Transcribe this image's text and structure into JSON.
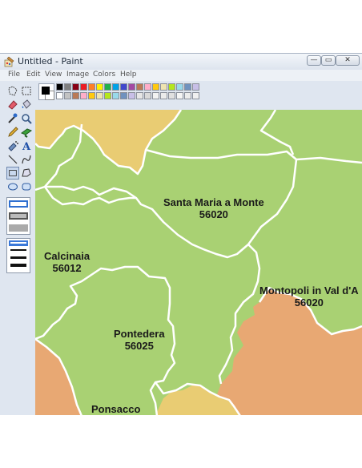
{
  "window": {
    "title": "Untitled - Paint"
  },
  "menu": [
    "File",
    "Edit",
    "View",
    "Image",
    "Colors",
    "Help"
  ],
  "window_controls": [
    {
      "name": "minimize",
      "symbol": "—"
    },
    {
      "name": "maximize",
      "symbol": "▭"
    },
    {
      "name": "close",
      "symbol": "✕"
    }
  ],
  "palette": {
    "primary_color": "#000000",
    "secondary_color": "#ffffff",
    "top_row": [
      "#000000",
      "#7f7f7f",
      "#880015",
      "#ed1c24",
      "#ff7f27",
      "#fff200",
      "#22b14c",
      "#00a2e8",
      "#3f48cc",
      "#a349a4",
      "#b97a57",
      "#ffaec9",
      "#ffc90e",
      "#efe4b0",
      "#b5e61d",
      "#99d9ea",
      "#7092be",
      "#c8bfe7"
    ],
    "bottom_row": [
      "#ffffff",
      "#c3c3c3",
      "#b97a57",
      "#ffaec9",
      "#ffc90e",
      "#efe4b0",
      "#b5e61d",
      "#99d9ea",
      "#7092be",
      "#c8bfe7",
      "#e6e6e6",
      "#d9d9d9",
      "#f2f2f2",
      "#ebebeb",
      "#e0e0e0",
      "#f5f5f5",
      "#ececec",
      "#f0f0f0"
    ]
  },
  "tools": [
    "free-select-icon",
    "rect-select-icon",
    "eraser-icon",
    "fill-icon",
    "eyedropper-icon",
    "magnifier-icon",
    "pencil-icon",
    "brush-icon",
    "airbrush-icon",
    "text-icon",
    "line-icon",
    "curve-icon",
    "rectangle-icon",
    "polygon-icon",
    "ellipse-icon",
    "rounded-rect-icon"
  ],
  "map": {
    "colors": {
      "green": "#a9d173",
      "yellow": "#e9cc73",
      "orange": "#e8a873",
      "border": "#ffffff"
    },
    "labels": [
      {
        "name": "Santa Maria a Monte",
        "code": "56020"
      },
      {
        "name": "Calcinaia",
        "code": "56012"
      },
      {
        "name": "Montopoli in Val d'A",
        "code": "56020"
      },
      {
        "name": "Pontedera",
        "code": "56025"
      },
      {
        "name": "Ponsacco",
        "code": ""
      }
    ]
  }
}
